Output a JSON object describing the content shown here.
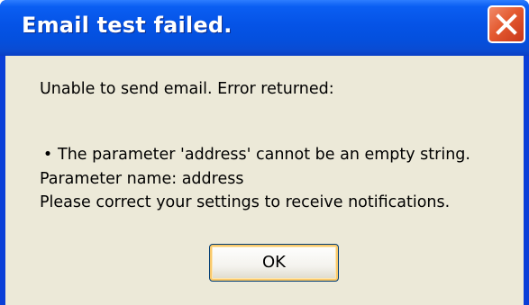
{
  "dialog": {
    "title": "Email test failed.",
    "close_icon": "close-icon",
    "message_intro": "Unable to send email.  Error returned:",
    "bullet_symbol": "•",
    "error_line": "The parameter 'address' cannot be an empty string.",
    "param_line": "Parameter name: address",
    "instruction": "Please correct your settings to receive notifications.",
    "ok_label": "OK"
  },
  "colors": {
    "titlebar": "#0553e6",
    "frame": "#0a3fd8",
    "client_bg": "#ece9d8",
    "close_button": "#e45a30"
  }
}
